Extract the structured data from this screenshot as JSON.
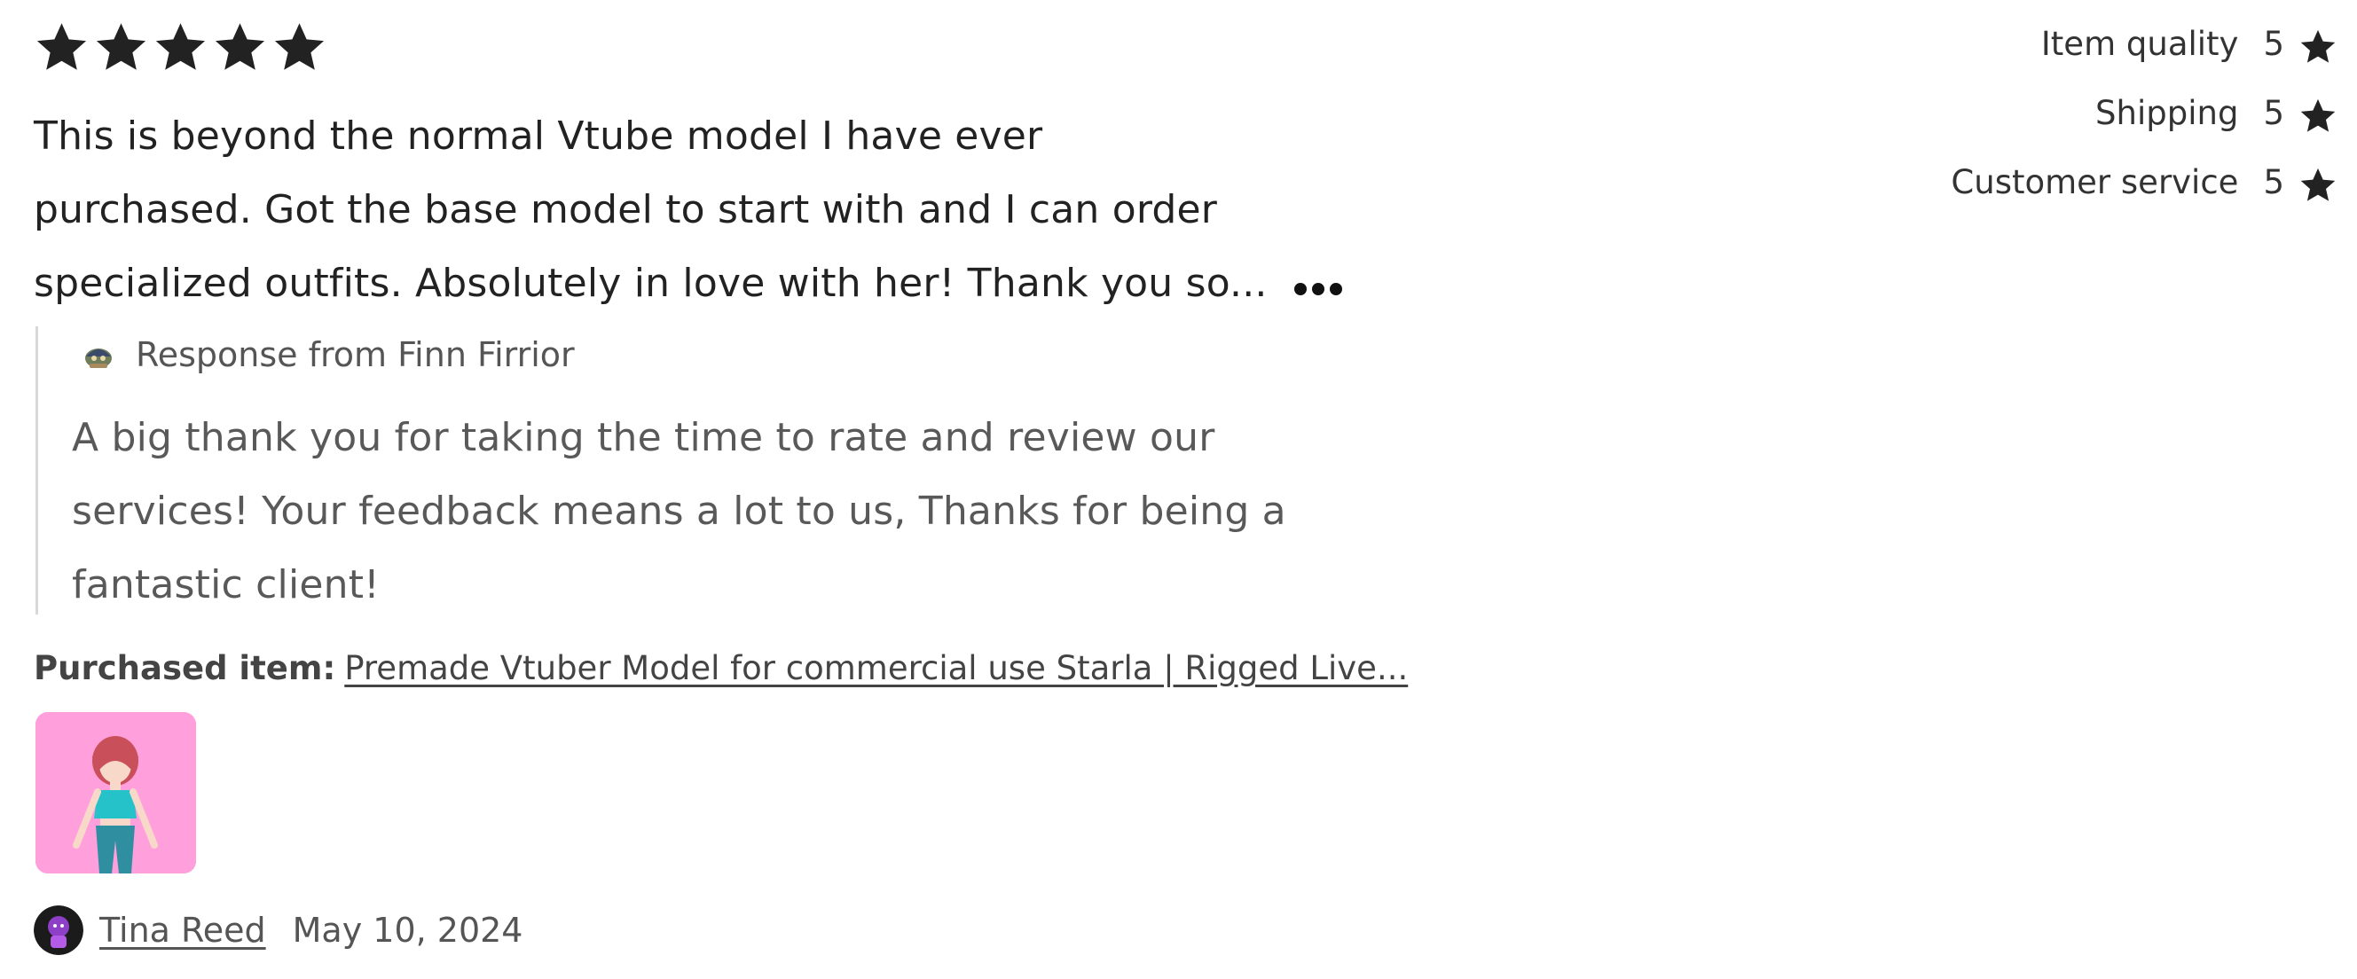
{
  "review": {
    "rating_stars": 5,
    "rating_max": 5,
    "text_lines": [
      "This is beyond the normal Vtube model I have ever",
      "purchased. Got the base model to start with and I can order",
      "specialized outfits. Absolutely in love with her! Thank you so..."
    ],
    "more_icon": "ellipsis-icon"
  },
  "response": {
    "from_label": "Response from Finn Firrior",
    "avatar_icon": "shop-avatar-icon",
    "text_lines": [
      "A big thank you for taking the time to rate and review our",
      "services! Your feedback means a lot to us, Thanks for being a",
      "fantastic client!"
    ]
  },
  "purchased": {
    "label": "Purchased item:",
    "item_title": "Premade Vtuber Model for commercial use Starla | Rigged Live..."
  },
  "reviewer": {
    "name": "Tina Reed",
    "date": "May 10, 2024"
  },
  "ratings": [
    {
      "label": "Item quality",
      "value": "5"
    },
    {
      "label": "Shipping",
      "value": "5"
    },
    {
      "label": "Customer service",
      "value": "5"
    }
  ],
  "colors": {
    "star": "#222222",
    "thumbnail_bg": "#ff9fdc",
    "response_border": "#d8d8d8"
  }
}
